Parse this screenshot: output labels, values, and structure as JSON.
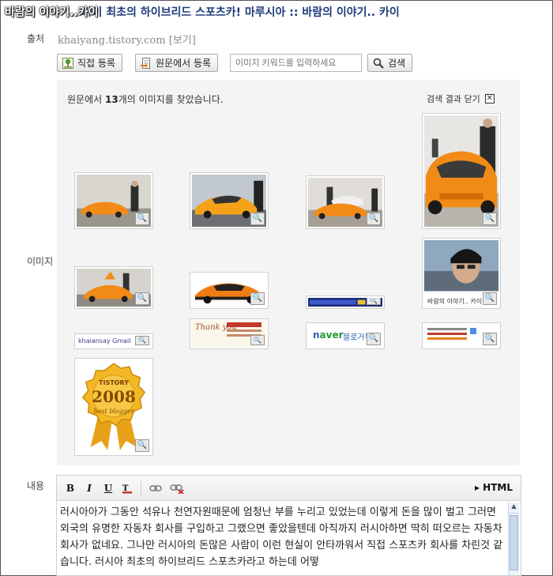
{
  "header": {
    "title_overlay": "바람의 이야기..카이",
    "title": "바람의 이야기.. 카이 최초의 하이브리드 스포츠카! 마루시아 :: 바람의 이야기.. 카이"
  },
  "source": {
    "label": "출처",
    "url": "khaiyang.tistory.com",
    "view_link": "[보기]"
  },
  "actions": {
    "direct_register": "직접 등록",
    "register_from_original": "원문에서 등록",
    "keyword_placeholder": "이미지 키워드를 입력하세요",
    "search_button": "검색"
  },
  "images": {
    "label": "이미지",
    "found_prefix": "원문에서 ",
    "found_count": "13",
    "found_suffix": "개의 이미지를 찾았습니다.",
    "close_results": "검색 결과 닫기",
    "thumbnail_texts": {
      "blog_banner": "바람의 이야기.. 카이",
      "gmail": "khaiansay Gmail",
      "thankyou": "Thank you",
      "naver": "블로거뉴",
      "tistory_top": "TISTORY",
      "tistory_year": "2008",
      "tistory_sub": "best blogger"
    }
  },
  "content": {
    "label": "내용",
    "html_mode": "HTML",
    "body": "러시아아가 그동안 석유나 천연자원때문에 엄청난 부를 누리고 있었는데 이렇게 돈을 많이 벌고 그러면 외국의 유명한 자동차 회사를 구입하고 그랬으면 좋았을텐데 아직까지 러시아하면 딱히 떠오르는 자동차 회사가 없네요. 그나만 러시아의 돈많은 사람이 이런 현실이 안타까워서 직접 스포츠카 회사를 차린것 같습니다. 러시아 최초의 하이브리드 스포츠카라고 하는데 어떻"
  },
  "colors": {
    "title": "#1e3a7a",
    "car_orange": "#f28a17",
    "panel_bg": "#f4f4f4"
  }
}
